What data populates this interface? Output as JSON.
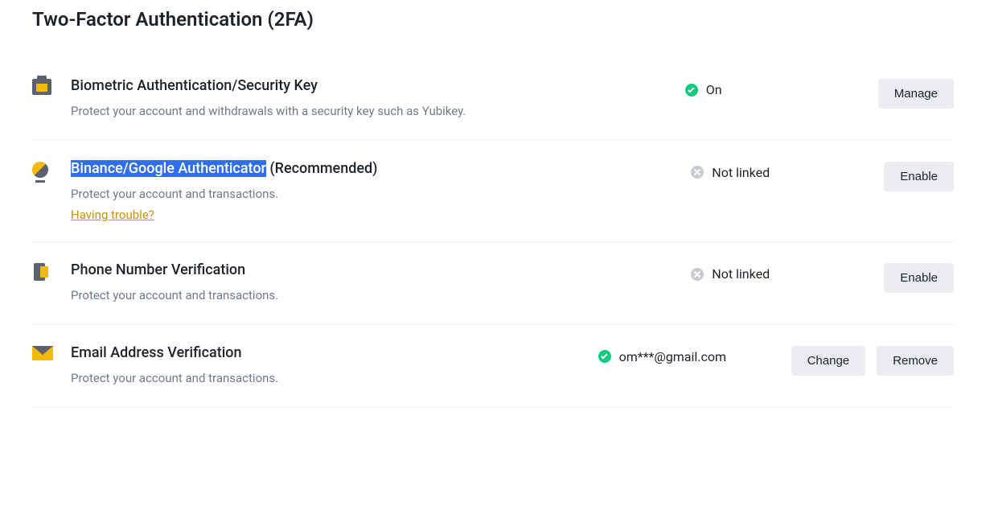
{
  "section": {
    "title": "Two-Factor Authentication (2FA)"
  },
  "items": [
    {
      "title": "Biometric Authentication/Security Key",
      "desc": "Protect your account and withdrawals with a security key such as Yubikey.",
      "status_on": true,
      "status_text": "On",
      "buttons": [
        "Manage"
      ],
      "highlight_title": "",
      "rest_title": "",
      "link": ""
    },
    {
      "title": "",
      "highlight_title": "Binance/Google Authenticator",
      "rest_title": " (Recommended)",
      "desc": "Protect your account and transactions.",
      "link": "Having trouble?",
      "status_on": false,
      "status_text": "Not linked",
      "buttons": [
        "Enable"
      ]
    },
    {
      "title": "Phone Number Verification",
      "desc": "Protect your account and transactions.",
      "status_on": false,
      "status_text": "Not linked",
      "buttons": [
        "Enable"
      ],
      "highlight_title": "",
      "rest_title": "",
      "link": ""
    },
    {
      "title": "Email Address Verification",
      "desc": "Protect your account and transactions.",
      "status_on": true,
      "status_text": "om***@gmail.com",
      "buttons": [
        "Change",
        "Remove"
      ],
      "highlight_title": "",
      "rest_title": "",
      "link": ""
    }
  ]
}
